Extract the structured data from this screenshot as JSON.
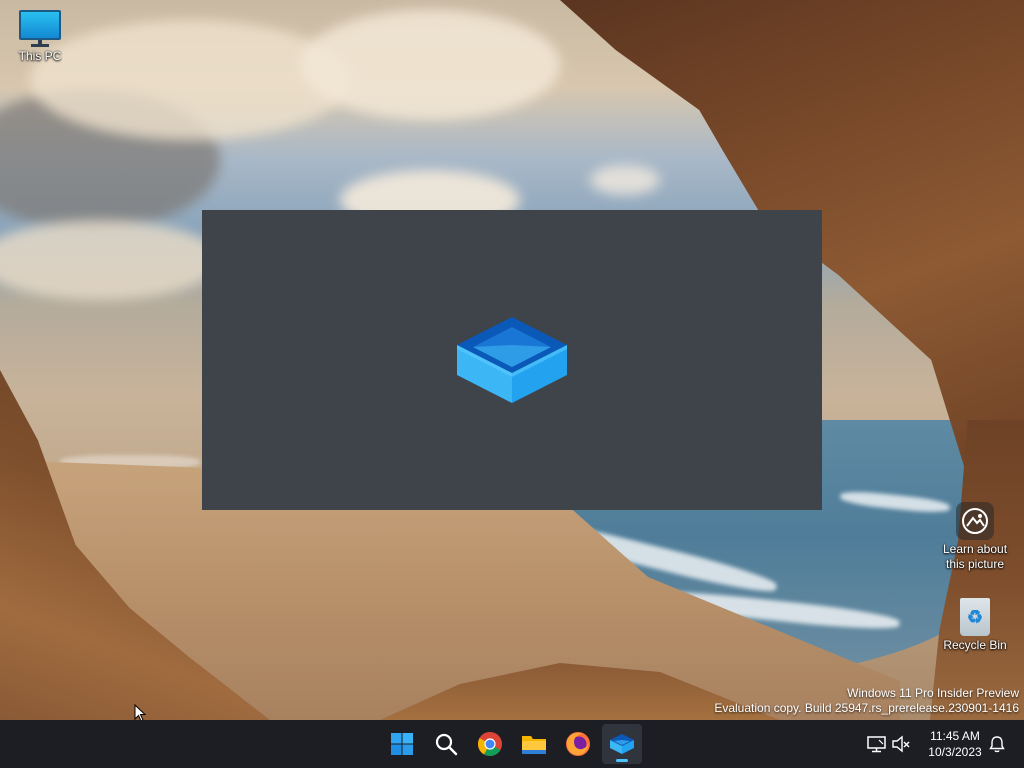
{
  "desktop": {
    "icons": {
      "this_pc": "This PC",
      "learn": "Learn about this picture",
      "recycle_bin": "Recycle Bin"
    },
    "watermark": {
      "line1": "Windows 11 Pro Insider Preview",
      "line2": "Evaluation copy. Build 25947.rs_prerelease.230901-1416"
    }
  },
  "splash": {
    "app_icon": "sandbox-box-icon"
  },
  "taskbar": {
    "apps": [
      "start-icon",
      "search-icon",
      "chrome-icon",
      "file-explorer-icon",
      "firefox-icon",
      "sandbox-icon"
    ],
    "active_app": "sandbox-icon",
    "tray": {
      "network": "network-icon",
      "volume": "volume-muted-icon",
      "time": "11:45 AM",
      "date": "10/3/2023",
      "notifications": "notification-bell-icon"
    }
  },
  "colors": {
    "taskbar_bg": "#1c1e24",
    "splash_bg": "#3f434a",
    "accent": "#4cc2ff"
  }
}
